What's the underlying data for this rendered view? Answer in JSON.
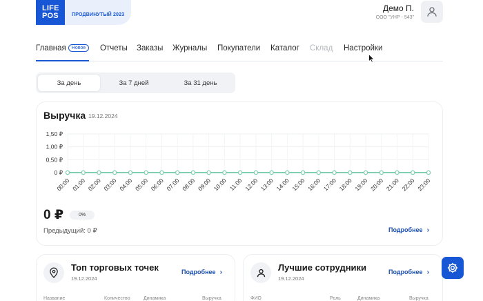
{
  "header": {
    "logo_line1": "LIFE",
    "logo_line2": "POS",
    "plan": "ПРОДВИНУТЫЙ 2023",
    "user_name": "Демо П.",
    "user_org": "ООО \"УНР - 543\"",
    "avatar_icon": "user-icon"
  },
  "nav": {
    "items": [
      {
        "label": "Главная",
        "badge": "Новое",
        "active": true
      },
      {
        "label": "Отчеты"
      },
      {
        "label": "Заказы"
      },
      {
        "label": "Журналы"
      },
      {
        "label": "Покупатели"
      },
      {
        "label": "Каталог"
      },
      {
        "label": "Склад",
        "disabled": true
      },
      {
        "label": "Настройки"
      }
    ]
  },
  "period": {
    "options": [
      "За день",
      "За 7 дней",
      "За 31 день"
    ],
    "selected": "За день"
  },
  "revenue": {
    "title": "Выручка",
    "date": "19.12.2024",
    "value": "0 ₽",
    "change": "0%",
    "previous": "Предыдущий: 0 ₽",
    "more": "Подробнее"
  },
  "chart_data": {
    "type": "line",
    "x": [
      "00:00",
      "01:00",
      "02:00",
      "03:00",
      "04:00",
      "05:00",
      "06:00",
      "07:00",
      "08:00",
      "09:00",
      "10:00",
      "11:00",
      "12:00",
      "13:00",
      "14:00",
      "15:00",
      "16:00",
      "17:00",
      "18:00",
      "19:00",
      "20:00",
      "21:00",
      "22:00",
      "23:00"
    ],
    "series": [
      {
        "values": [
          0,
          0,
          0,
          0,
          0,
          0,
          0,
          0,
          0,
          0,
          0,
          0,
          0,
          0,
          0,
          0,
          0,
          0,
          0,
          0,
          0,
          0,
          0,
          0
        ],
        "color": "#7fd0b0"
      }
    ],
    "y_ticks": [
      "0 ₽",
      "0,50 ₽",
      "1,00 ₽",
      "1,50 ₽"
    ],
    "ylim": [
      0,
      1.5
    ],
    "grid": true
  },
  "top_stores": {
    "title": "Топ торговых точек",
    "date": "19.12.2024",
    "more": "Подробнее",
    "icon": "location-pin-icon",
    "columns": [
      "Название",
      "Количество",
      "Динамика",
      "Выручка"
    ]
  },
  "best_staff": {
    "title": "Лучшие сотрудники",
    "date": "19.12.2024",
    "more": "Подробнее",
    "icon": "user-icon",
    "columns": [
      "ФИО",
      "Роль",
      "Динамика",
      "Выручка"
    ]
  },
  "fab": {
    "icon": "gear-icon"
  },
  "colors": {
    "accent": "#1756d4",
    "line": "#7fd0b0",
    "link": "#1b4fb3"
  }
}
